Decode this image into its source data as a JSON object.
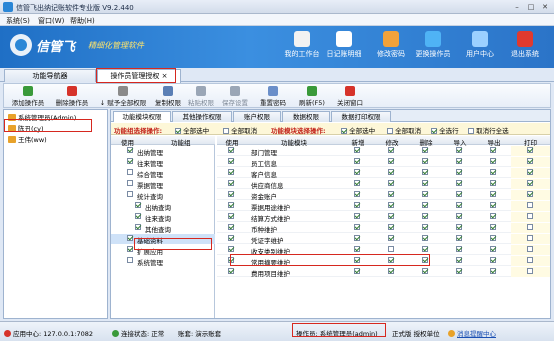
{
  "window": {
    "title": "信管飞出纳记账软件专业版 V9.2.440"
  },
  "menu": {
    "items": [
      "系统(S)",
      "窗口(W)",
      "帮助(H)"
    ]
  },
  "banner": {
    "logo_text": "信管飞",
    "logo_sub": "精细化管理软件",
    "nav": [
      {
        "label": "我的工作台",
        "icon": "desk-icon",
        "color": "#f2f2f2"
      },
      {
        "label": "日记账明细",
        "icon": "ledger-icon",
        "color": "#ffffff"
      },
      {
        "label": "修改密码",
        "icon": "key-icon",
        "color": "#f2a23a"
      },
      {
        "label": "更换操作员",
        "icon": "user-switch-icon",
        "color": "#4fb3f5"
      },
      {
        "label": "用户中心",
        "icon": "user-center-icon",
        "color": "#9bd0ff"
      },
      {
        "label": "退出系统",
        "icon": "power-icon",
        "color": "#e03a2f"
      }
    ]
  },
  "outer_tabs": [
    {
      "label": "功能导航器"
    },
    {
      "label": "操作员管理授权"
    }
  ],
  "toolbar": [
    {
      "label": "添加操作员",
      "icon": "add-user-icon",
      "color": "#3a9a3a",
      "disabled": false
    },
    {
      "label": "删除操作员",
      "icon": "delete-user-icon",
      "color": "#d6332a",
      "disabled": false
    },
    {
      "label": "↓ 赋予全部权限",
      "icon": "grant-icon",
      "color": "#8a8a8a",
      "disabled": false
    },
    {
      "label": "复制权限",
      "icon": "copy-icon",
      "color": "#5a7fb5",
      "disabled": false
    },
    {
      "label": "粘贴权限",
      "icon": "paste-icon",
      "color": "#9aa6b6",
      "disabled": true
    },
    {
      "label": "保存设置",
      "icon": "save-icon",
      "color": "#9aa6b6",
      "disabled": true
    },
    {
      "label": "重置密码",
      "icon": "reset-password-icon",
      "color": "#6b8fc9",
      "disabled": false
    },
    {
      "label": "刷新(F5)",
      "icon": "refresh-icon",
      "color": "#3a9a3a",
      "disabled": false
    },
    {
      "label": "关闭窗口",
      "icon": "close-window-icon",
      "color": "#d6332a",
      "disabled": false
    }
  ],
  "operators": [
    {
      "label": "系统管理员(Admin)"
    },
    {
      "label": "陈丑(cy)"
    },
    {
      "label": "王伟(ww)"
    }
  ],
  "inner_tabs": [
    {
      "label": "功能模块权限"
    },
    {
      "label": "其他操作权限"
    },
    {
      "label": "账户权限"
    },
    {
      "label": "数据权限"
    },
    {
      "label": "数据打印权限"
    }
  ],
  "op_bar": {
    "group_title": "功能组选择操作:",
    "group_all": "全部选中",
    "group_none": "全部取消",
    "module_title": "功能模块选择操作:",
    "module_all": "全部选中",
    "module_none": "全部取消",
    "select_all": "全选行",
    "cancel_all": "取消行全选"
  },
  "module_tree": {
    "headers": [
      "使用",
      "功能组"
    ],
    "rows": [
      {
        "label": "出纳管理",
        "checked": true,
        "indent": 1
      },
      {
        "label": "往来管理",
        "checked": true,
        "indent": 1
      },
      {
        "label": "综合管理",
        "checked": false,
        "indent": 1
      },
      {
        "label": "票据管理",
        "checked": false,
        "indent": 1
      },
      {
        "label": "统计查询",
        "checked": false,
        "indent": 1
      },
      {
        "label": "出纳查询",
        "checked": true,
        "indent": 2
      },
      {
        "label": "往来查询",
        "checked": true,
        "indent": 2
      },
      {
        "label": "其他查询",
        "checked": true,
        "indent": 2
      },
      {
        "label": "基础资料",
        "checked": true,
        "indent": 1
      },
      {
        "label": "扩展应用",
        "checked": true,
        "indent": 1
      },
      {
        "label": "系统管理",
        "checked": false,
        "indent": 1
      }
    ]
  },
  "function_grid": {
    "headers": [
      "使用",
      "功能模块",
      "新增",
      "修改",
      "删除",
      "导入",
      "导出",
      "打印"
    ],
    "rows": [
      {
        "name": "部门管理",
        "use": true,
        "perms": [
          true,
          true,
          true,
          true,
          true,
          true
        ]
      },
      {
        "name": "员工信息",
        "use": true,
        "perms": [
          true,
          true,
          true,
          true,
          true,
          true
        ]
      },
      {
        "name": "客户信息",
        "use": true,
        "perms": [
          true,
          true,
          true,
          true,
          true,
          true
        ]
      },
      {
        "name": "供应商信息",
        "use": true,
        "perms": [
          true,
          true,
          true,
          true,
          true,
          true
        ]
      },
      {
        "name": "资金账户",
        "use": true,
        "perms": [
          true,
          true,
          true,
          true,
          true,
          true
        ]
      },
      {
        "name": "票据用途维护",
        "use": true,
        "perms": [
          true,
          true,
          true,
          true,
          true,
          false
        ]
      },
      {
        "name": "结算方式维护",
        "use": true,
        "perms": [
          true,
          true,
          true,
          true,
          true,
          false
        ]
      },
      {
        "name": "币种维护",
        "use": true,
        "perms": [
          true,
          true,
          true,
          true,
          true,
          false
        ]
      },
      {
        "name": "凭证字维护",
        "use": true,
        "perms": [
          true,
          true,
          true,
          true,
          true,
          false
        ]
      },
      {
        "name": "收支类别维护",
        "use": true,
        "perms": [
          true,
          false,
          true,
          true,
          true,
          false
        ]
      },
      {
        "name": "常用摘要维护",
        "use": true,
        "perms": [
          true,
          true,
          true,
          true,
          true,
          false
        ]
      },
      {
        "name": "费用项目维护",
        "use": true,
        "perms": [
          true,
          true,
          true,
          true,
          true,
          false
        ]
      }
    ]
  },
  "status": {
    "app_center": "应用中心: 127.0.0.1:7082",
    "connection": "连接状态: 正常",
    "account": "账套: 演示账套",
    "operator": "操作员: 系统管理员(admin)",
    "license": "正式版 授权单位",
    "help": "消息提醒中心"
  }
}
